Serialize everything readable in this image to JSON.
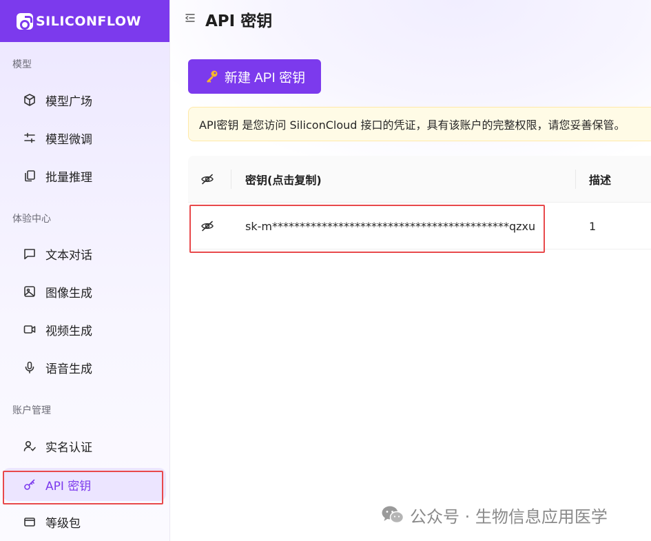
{
  "brand": {
    "logo_text": "SILICONFLOW",
    "accent": "#7c3aed"
  },
  "sidebar": {
    "sections": [
      {
        "label": "模型"
      },
      {
        "label": "体验中心"
      },
      {
        "label": "账户管理"
      }
    ],
    "items": [
      {
        "label": "模型广场",
        "icon": "cube-icon"
      },
      {
        "label": "模型微调",
        "icon": "sliders-icon"
      },
      {
        "label": "批量推理",
        "icon": "copy-stack-icon"
      },
      {
        "label": "文本对话",
        "icon": "chat-bubble-icon"
      },
      {
        "label": "图像生成",
        "icon": "image-icon"
      },
      {
        "label": "视频生成",
        "icon": "video-camera-icon"
      },
      {
        "label": "语音生成",
        "icon": "microphone-icon"
      },
      {
        "label": "实名认证",
        "icon": "user-check-icon"
      },
      {
        "label": "API 密钥",
        "icon": "key-icon",
        "active": true
      },
      {
        "label": "等级包",
        "icon": "wallet-icon"
      }
    ]
  },
  "header": {
    "title": "API 密钥"
  },
  "main": {
    "new_key_button": "新建 API 密钥",
    "notice": "API密钥 是您访问 SiliconCloud 接口的凭证，具有该账户的完整权限，请您妥善保管。",
    "table": {
      "columns": [
        "密钥(点击复制)",
        "描述"
      ],
      "rows": [
        {
          "key": "sk-m*******************************************qzxu",
          "description": "1"
        }
      ]
    }
  },
  "watermark": {
    "text": "公众号 · 生物信息应用医学"
  }
}
